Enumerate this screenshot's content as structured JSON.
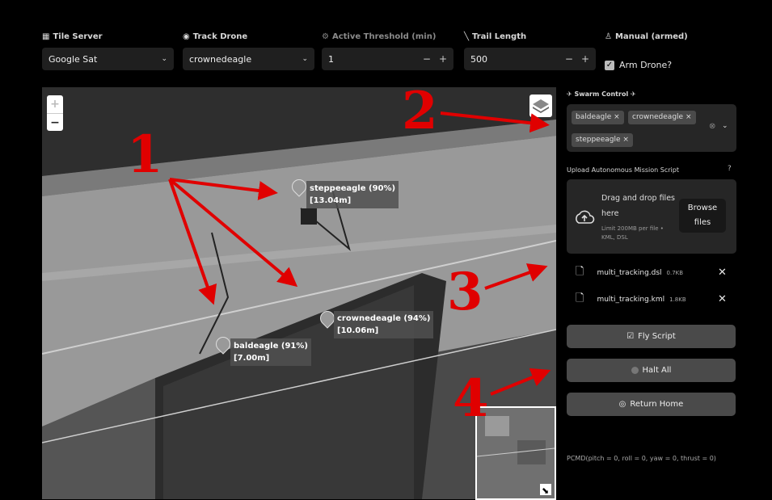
{
  "toolbar": {
    "tile_server": {
      "label": "Tile Server",
      "value": "Google Sat"
    },
    "track_drone": {
      "label": "Track Drone",
      "value": "crownedeagle"
    },
    "active_threshold": {
      "label": "Active Threshold (min)",
      "value": "1"
    },
    "trail_length": {
      "label": "Trail Length",
      "value": "500"
    },
    "manual": {
      "label": "Manual (armed)",
      "checkbox_label": "Arm Drone?",
      "checked": true
    }
  },
  "map": {
    "zoom_in": "+",
    "zoom_out": "−",
    "markers": [
      {
        "name": "steppeeagle (90%)",
        "dist": "[13.04m]"
      },
      {
        "name": "crownedeagle (94%)",
        "dist": "[10.06m]"
      },
      {
        "name": "baldeagle (91%)",
        "dist": "[7.00m]"
      }
    ]
  },
  "panel": {
    "swarm_title": "Swarm Control",
    "swarm_chips": [
      "baldeagle",
      "crownedeagle",
      "steppeeagle"
    ],
    "upload_title": "Upload Autonomous Mission Script",
    "upload_drag": "Drag and drop files here",
    "upload_limit": "Limit 200MB per file • KML, DSL",
    "browse": "Browse files",
    "files": [
      {
        "name": "multi_tracking.dsl",
        "size": "0.7KB"
      },
      {
        "name": "multi_tracking.kml",
        "size": "1.8KB"
      }
    ],
    "fly_script": "Fly Script",
    "halt_all": "Halt All",
    "return_home": "Return Home",
    "pcmd": "PCMD(pitch = 0, roll = 0, yaw = 0, thrust = 0)"
  },
  "annotations": [
    "1",
    "2",
    "3",
    "4"
  ],
  "colors": {
    "annotation_red": "#e00000",
    "panel_bg": "#262626",
    "button_bg": "#4a4a4a"
  },
  "icons": [
    "map-icon",
    "drone-icon",
    "threshold-icon",
    "ruler-icon",
    "joystick-icon",
    "cloud-upload-icon",
    "file-icon",
    "close-icon",
    "help-icon",
    "layers-icon",
    "expand-icon"
  ]
}
